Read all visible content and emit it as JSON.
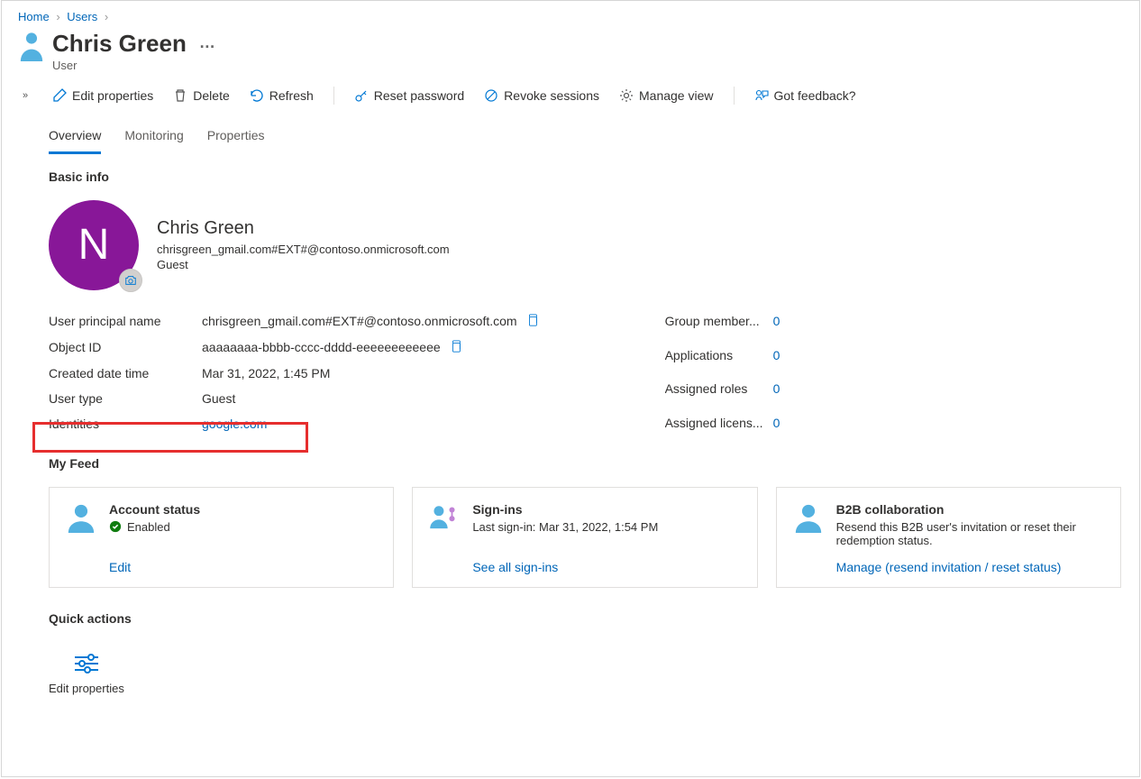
{
  "breadcrumb": {
    "home": "Home",
    "users": "Users"
  },
  "header": {
    "title": "Chris Green",
    "subtitle": "User"
  },
  "toolbar": {
    "edit": "Edit properties",
    "delete": "Delete",
    "refresh": "Refresh",
    "reset_pw": "Reset password",
    "revoke": "Revoke sessions",
    "manage_view": "Manage view",
    "feedback": "Got feedback?"
  },
  "tabs": {
    "overview": "Overview",
    "monitoring": "Monitoring",
    "properties": "Properties"
  },
  "basic": {
    "heading": "Basic info",
    "avatar_initial": "N",
    "name": "Chris Green",
    "upn_display": "chrisgreen_gmail.com#EXT#@contoso.onmicrosoft.com",
    "type_display": "Guest",
    "props": {
      "upn": {
        "label": "User principal name",
        "value": "chrisgreen_gmail.com#EXT#@contoso.onmicrosoft.com"
      },
      "object_id": {
        "label": "Object ID",
        "value": "aaaaaaaa-bbbb-cccc-dddd-eeeeeeeeeeee"
      },
      "created": {
        "label": "Created date time",
        "value": "Mar 31, 2022, 1:45 PM"
      },
      "user_type": {
        "label": "User type",
        "value": "Guest"
      },
      "identities": {
        "label": "Identities",
        "value": "google.com"
      }
    },
    "right": {
      "group_member": {
        "label": "Group member...",
        "value": "0"
      },
      "applications": {
        "label": "Applications",
        "value": "0"
      },
      "assigned_roles": {
        "label": "Assigned roles",
        "value": "0"
      },
      "assigned_licens": {
        "label": "Assigned licens...",
        "value": "0"
      }
    }
  },
  "feed": {
    "heading": "My Feed",
    "cards": {
      "account": {
        "title": "Account status",
        "status": "Enabled",
        "link": "Edit"
      },
      "signins": {
        "title": "Sign-ins",
        "line": "Last sign-in: Mar 31, 2022, 1:54 PM",
        "link": "See all sign-ins"
      },
      "b2b": {
        "title": "B2B collaboration",
        "line": "Resend this B2B user's invitation or reset their redemption status.",
        "link": "Manage (resend invitation / reset status)"
      }
    }
  },
  "quick": {
    "heading": "Quick actions",
    "edit_props": "Edit properties"
  }
}
